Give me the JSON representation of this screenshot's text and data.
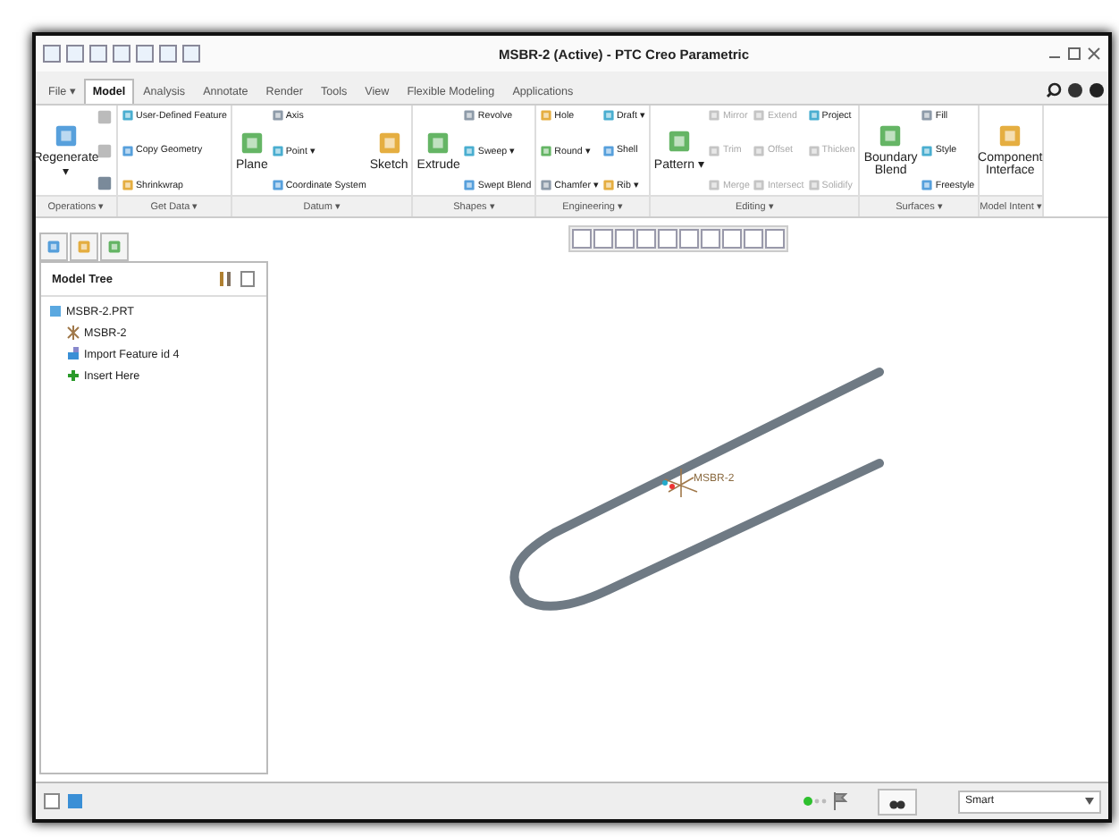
{
  "window": {
    "title": "MSBR-2 (Active) - PTC Creo Parametric"
  },
  "tabs": [
    {
      "label": "File ▾",
      "selected": false
    },
    {
      "label": "Model",
      "selected": true
    },
    {
      "label": "Analysis",
      "selected": false
    },
    {
      "label": "Annotate",
      "selected": false
    },
    {
      "label": "Render",
      "selected": false
    },
    {
      "label": "Tools",
      "selected": false
    },
    {
      "label": "View",
      "selected": false
    },
    {
      "label": "Flexible Modeling",
      "selected": false
    },
    {
      "label": "Applications",
      "selected": false
    }
  ],
  "ribbon": [
    {
      "label": "Operations ▾",
      "columns": [
        [
          {
            "kind": "large",
            "label": "Regenerate ▾",
            "disabled": false
          }
        ],
        [
          {
            "kind": "icon",
            "disabled": true
          },
          {
            "kind": "icon",
            "disabled": true
          },
          {
            "kind": "icon",
            "disabled": false
          }
        ]
      ]
    },
    {
      "label": "Get Data ▾",
      "columns": [
        [
          {
            "kind": "small",
            "label": "User-Defined Feature",
            "disabled": false
          },
          {
            "kind": "small",
            "label": "Copy Geometry",
            "disabled": false
          },
          {
            "kind": "small",
            "label": "Shrinkwrap",
            "disabled": false
          }
        ]
      ]
    },
    {
      "label": "Datum ▾",
      "columns": [
        [
          {
            "kind": "large",
            "label": "Plane",
            "disabled": false
          }
        ],
        [
          {
            "kind": "small",
            "label": "Axis",
            "disabled": false
          },
          {
            "kind": "small",
            "label": "Point ▾",
            "disabled": false
          },
          {
            "kind": "small",
            "label": "Coordinate System",
            "disabled": false
          }
        ],
        [
          {
            "kind": "large",
            "label": "Sketch",
            "disabled": false
          }
        ]
      ]
    },
    {
      "label": "Shapes ▾",
      "columns": [
        [
          {
            "kind": "large",
            "label": "Extrude",
            "disabled": false
          }
        ],
        [
          {
            "kind": "small",
            "label": "Revolve",
            "disabled": false
          },
          {
            "kind": "small",
            "label": "Sweep ▾",
            "disabled": false
          },
          {
            "kind": "small",
            "label": "Swept Blend",
            "disabled": false
          }
        ]
      ]
    },
    {
      "label": "Engineering ▾",
      "columns": [
        [
          {
            "kind": "small",
            "label": "Hole",
            "disabled": false
          },
          {
            "kind": "small",
            "label": "Round ▾",
            "disabled": false
          },
          {
            "kind": "small",
            "label": "Chamfer ▾",
            "disabled": false
          }
        ],
        [
          {
            "kind": "small",
            "label": "Draft ▾",
            "disabled": false
          },
          {
            "kind": "small",
            "label": "Shell",
            "disabled": false
          },
          {
            "kind": "small",
            "label": "Rib ▾",
            "disabled": false
          }
        ]
      ]
    },
    {
      "label": "Editing ▾",
      "columns": [
        [
          {
            "kind": "large",
            "label": "Pattern ▾",
            "disabled": false
          }
        ],
        [
          {
            "kind": "small",
            "label": "Mirror",
            "disabled": true
          },
          {
            "kind": "small",
            "label": "Trim",
            "disabled": true
          },
          {
            "kind": "small",
            "label": "Merge",
            "disabled": true
          }
        ],
        [
          {
            "kind": "small",
            "label": "Extend",
            "disabled": true
          },
          {
            "kind": "small",
            "label": "Offset",
            "disabled": true
          },
          {
            "kind": "small",
            "label": "Intersect",
            "disabled": true
          }
        ],
        [
          {
            "kind": "small",
            "label": "Project",
            "disabled": false
          },
          {
            "kind": "small",
            "label": "Thicken",
            "disabled": true
          },
          {
            "kind": "small",
            "label": "Solidify",
            "disabled": true
          }
        ]
      ]
    },
    {
      "label": "Surfaces ▾",
      "columns": [
        [
          {
            "kind": "large",
            "label": "Boundary Blend",
            "disabled": false
          }
        ],
        [
          {
            "kind": "small",
            "label": "Fill",
            "disabled": false
          },
          {
            "kind": "small",
            "label": "Style",
            "disabled": false
          },
          {
            "kind": "small",
            "label": "Freestyle",
            "disabled": false
          }
        ]
      ]
    },
    {
      "label": "Model Intent ▾",
      "columns": [
        [
          {
            "kind": "large",
            "label": "Component Interface",
            "disabled": false
          }
        ]
      ]
    }
  ],
  "model_tree": {
    "title": "Model Tree",
    "items": [
      {
        "label": "MSBR-2.PRT",
        "kind": "part",
        "children": [
          {
            "label": "MSBR-2",
            "kind": "csys"
          },
          {
            "label": "Import Feature id 4",
            "kind": "import"
          },
          {
            "label": "Insert Here",
            "kind": "insert"
          }
        ]
      }
    ]
  },
  "viewport": {
    "csys_label": "MSBR-2"
  },
  "status_bar": {
    "selection_filter": "Smart"
  }
}
